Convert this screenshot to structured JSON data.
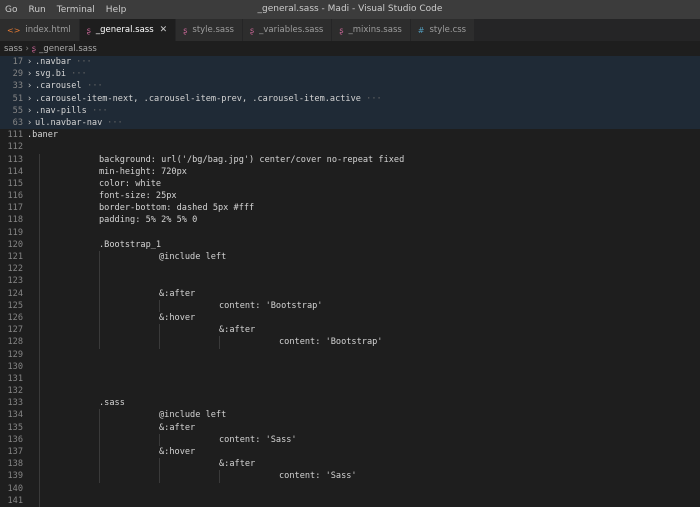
{
  "titlebar": {
    "menu": [
      "Go",
      "Run",
      "Terminal",
      "Help"
    ],
    "title": "_general.sass - Madi - Visual Studio Code"
  },
  "tabs": [
    {
      "label": "index.html",
      "icon": "html-file-icon",
      "active": false
    },
    {
      "label": "_general.sass",
      "icon": "sass-file-icon",
      "active": true
    },
    {
      "label": "style.sass",
      "icon": "sass-file-icon",
      "active": false
    },
    {
      "label": "_variables.sass",
      "icon": "sass-file-icon",
      "active": false
    },
    {
      "label": "_mixins.sass",
      "icon": "sass-file-icon",
      "active": false
    },
    {
      "label": "style.css",
      "icon": "css-file-icon",
      "active": false
    }
  ],
  "breadcrumb": {
    "folder": "sass",
    "file": "_general.sass"
  },
  "editor": {
    "lines": [
      {
        "n": "17",
        "indent": 0,
        "text": ".navbar",
        "folded": true
      },
      {
        "n": "29",
        "indent": 0,
        "text": "svg.bi",
        "folded": true
      },
      {
        "n": "33",
        "indent": 0,
        "text": ".carousel",
        "folded": true
      },
      {
        "n": "51",
        "indent": 0,
        "text": ".carousel-item-next, .carousel-item-prev, .carousel-item.active",
        "folded": true
      },
      {
        "n": "55",
        "indent": 0,
        "text": ".nav-pills",
        "folded": true
      },
      {
        "n": "63",
        "indent": 0,
        "text": "ul.navbar-nav",
        "folded": true
      },
      {
        "n": "111",
        "indent": 0,
        "text": ".baner",
        "folded": false
      },
      {
        "n": "112",
        "indent": 1,
        "text": "",
        "folded": false
      },
      {
        "n": "113",
        "indent": 2,
        "text": "background: url('/bg/bag.jpg') center/cover no-repeat fixed",
        "folded": false
      },
      {
        "n": "114",
        "indent": 2,
        "text": "min-height: 720px",
        "folded": false
      },
      {
        "n": "115",
        "indent": 2,
        "text": "color: white",
        "folded": false
      },
      {
        "n": "116",
        "indent": 2,
        "text": "font-size: 25px",
        "folded": false
      },
      {
        "n": "117",
        "indent": 2,
        "text": "border-bottom: dashed 5px #fff",
        "folded": false
      },
      {
        "n": "118",
        "indent": 2,
        "text": "padding: 5% 2% 5% 0",
        "folded": false
      },
      {
        "n": "119",
        "indent": 2,
        "text": "",
        "folded": false
      },
      {
        "n": "120",
        "indent": 2,
        "text": ".Bootstrap_1",
        "folded": false
      },
      {
        "n": "121",
        "indent": 3,
        "text": "@include left",
        "folded": false
      },
      {
        "n": "122",
        "indent": 3,
        "text": "",
        "folded": false
      },
      {
        "n": "123",
        "indent": 3,
        "text": "",
        "folded": false
      },
      {
        "n": "124",
        "indent": 3,
        "text": "&:after",
        "folded": false
      },
      {
        "n": "125",
        "indent": 4,
        "text": "content: 'Bootstrap'",
        "folded": false
      },
      {
        "n": "126",
        "indent": 3,
        "text": "&:hover",
        "folded": false
      },
      {
        "n": "127",
        "indent": 4,
        "text": "&:after",
        "folded": false
      },
      {
        "n": "128",
        "indent": 5,
        "text": "content: 'Bootstrap'",
        "folded": false
      },
      {
        "n": "129",
        "indent": 2,
        "text": "",
        "folded": false
      },
      {
        "n": "130",
        "indent": 2,
        "text": "",
        "folded": false
      },
      {
        "n": "131",
        "indent": 2,
        "text": "",
        "folded": false
      },
      {
        "n": "132",
        "indent": 2,
        "text": "",
        "folded": false
      },
      {
        "n": "133",
        "indent": 2,
        "text": ".sass",
        "folded": false
      },
      {
        "n": "134",
        "indent": 3,
        "text": "@include left",
        "folded": false
      },
      {
        "n": "135",
        "indent": 3,
        "text": "&:after",
        "folded": false
      },
      {
        "n": "136",
        "indent": 4,
        "text": "content: 'Sass'",
        "folded": false
      },
      {
        "n": "137",
        "indent": 3,
        "text": "&:hover",
        "folded": false
      },
      {
        "n": "138",
        "indent": 4,
        "text": "&:after",
        "folded": false
      },
      {
        "n": "139",
        "indent": 5,
        "text": "content: 'Sass'",
        "folded": false
      },
      {
        "n": "140",
        "indent": 2,
        "text": "",
        "folded": false
      },
      {
        "n": "141",
        "indent": 2,
        "text": "",
        "folded": false
      }
    ]
  }
}
